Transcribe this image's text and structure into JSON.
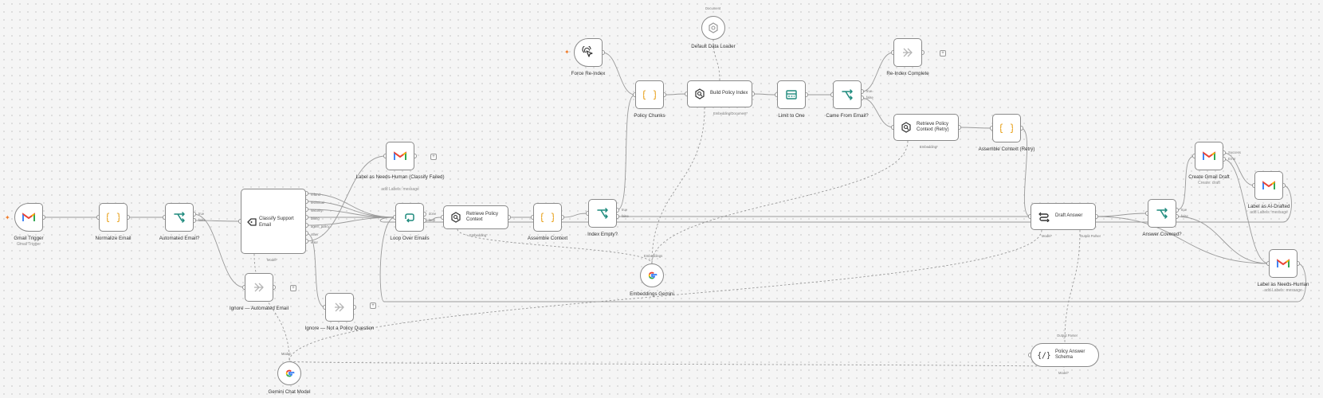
{
  "colors": {
    "accent": "#f07a27",
    "teal": "#1e8a7d",
    "gold": "#e8a11b",
    "wire": "#9a9a9a"
  },
  "nodes": [
    {
      "id": "gmail-trigger",
      "label": "Gmail Trigger",
      "sub": "Gmail Trigger",
      "icon": "gmail-icon"
    },
    {
      "id": "normalize-email",
      "label": "Normalize Email",
      "icon": "code-braces-icon"
    },
    {
      "id": "automated-email",
      "label": "Automated Email?",
      "icon": "if-branch-icon",
      "ports": [
        "true",
        "false"
      ]
    },
    {
      "id": "classify-support-email",
      "label": "Classify Support Email",
      "icon": "tag-icon",
      "ports": [
        "refund",
        "technical",
        "security",
        "billing",
        "agent_policy",
        "other",
        "error"
      ],
      "bottom_port": "Model*"
    },
    {
      "id": "ignore-automated",
      "label": "Ignore — Automated Email",
      "icon": "noop-arrow-icon"
    },
    {
      "id": "ignore-not-policy",
      "label": "Ignore — Not a Policy Question",
      "icon": "noop-arrow-icon"
    },
    {
      "id": "label-needs-human-classify",
      "label": "Label as Needs-Human (Classify Failed)",
      "sub": "add Labels: message",
      "icon": "gmail-icon"
    },
    {
      "id": "loop-over-emails",
      "label": "Loop Over Emails",
      "icon": "loop-icon",
      "ports": [
        "done",
        "loop"
      ]
    },
    {
      "id": "retrieve-policy-context",
      "label": "Retrieve Policy Context",
      "icon": "vector-search-icon",
      "bottom_port": "Embedding*"
    },
    {
      "id": "assemble-context",
      "label": "Assemble Context",
      "icon": "code-braces-icon"
    },
    {
      "id": "index-empty",
      "label": "Index Empty?",
      "icon": "if-branch-icon",
      "ports": [
        "true",
        "false"
      ]
    },
    {
      "id": "embeddings-gemini",
      "label": "Embeddings Gemini",
      "icon": "google-icon",
      "top_port": "Embeddings"
    },
    {
      "id": "force-reindex",
      "label": "Force Re-Index",
      "icon": "pointer-click-icon"
    },
    {
      "id": "policy-chunks",
      "label": "Policy Chunks",
      "icon": "code-braces-icon"
    },
    {
      "id": "build-policy-index",
      "label": "Build Policy Index",
      "icon": "vector-search-icon",
      "bottom_port": "Embedding/Document*"
    },
    {
      "id": "default-data-loader",
      "label": "Default Data Loader",
      "icon": "document-loader-icon",
      "top_port": "Document"
    },
    {
      "id": "limit-to-one",
      "label": "Limit to One",
      "icon": "limit-icon"
    },
    {
      "id": "came-from-email",
      "label": "Came From Email?",
      "icon": "if-branch-icon",
      "ports": [
        "true",
        "false"
      ]
    },
    {
      "id": "reindex-complete",
      "label": "Re-Index Complete",
      "icon": "noop-arrow-icon"
    },
    {
      "id": "retrieve-policy-context-retry",
      "label": "Retrieve Policy Context (Retry)",
      "icon": "vector-search-icon",
      "bottom_port": "Embedding*"
    },
    {
      "id": "assemble-context-retry",
      "label": "Assemble Context (Retry)",
      "icon": "code-braces-icon"
    },
    {
      "id": "draft-answer",
      "label": "Draft Answer",
      "icon": "chain-icon",
      "bottom_ports": [
        "Model*",
        "Output Parser"
      ]
    },
    {
      "id": "answer-covered",
      "label": "Answer Covered?",
      "icon": "if-branch-icon",
      "ports": [
        "true",
        "false"
      ]
    },
    {
      "id": "create-gmail-draft",
      "label": "Create Gmail Draft",
      "sub": "Create: draft",
      "icon": "gmail-icon",
      "ports": [
        "Success",
        "Error"
      ]
    },
    {
      "id": "label-ai-drafted",
      "label": "Label as AI-Drafted",
      "sub": "add Labels: message",
      "icon": "gmail-icon"
    },
    {
      "id": "label-needs-human",
      "label": "Label as Needs-Human",
      "sub": "add Labels: message",
      "icon": "gmail-icon"
    },
    {
      "id": "policy-answer-schema",
      "label": "Policy Answer Schema",
      "icon": "json-schema-icon",
      "top_port": "Output Parser",
      "bottom_port": "Model*"
    },
    {
      "id": "gemini-chat-model",
      "label": "Gemini Chat Model",
      "icon": "google-icon",
      "top_port": "Model"
    }
  ]
}
